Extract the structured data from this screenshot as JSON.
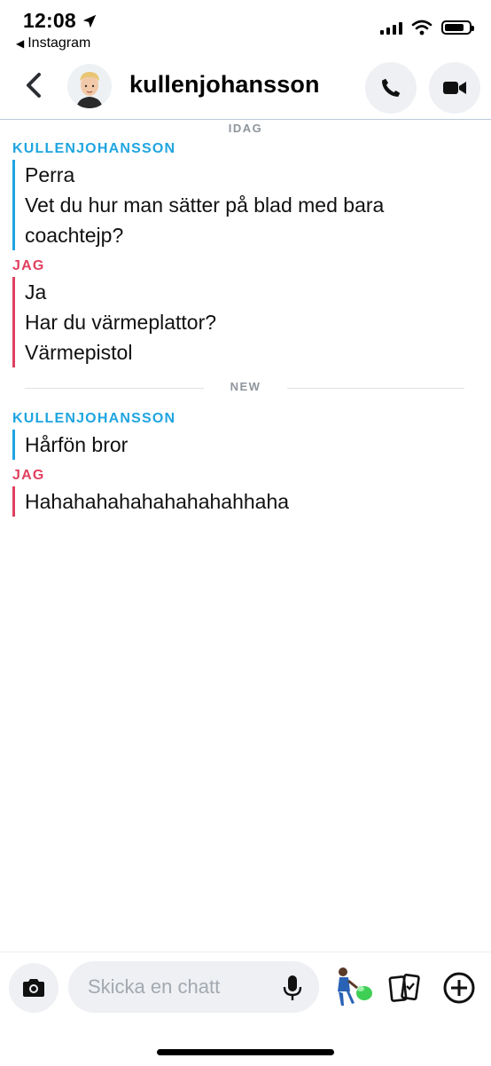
{
  "status_bar": {
    "time": "12:08",
    "back_app": "Instagram",
    "battery_level": 0.8
  },
  "header": {
    "contact_name": "kullenjohansson"
  },
  "chat": {
    "day_label": "IDAG",
    "new_label": "NEW",
    "groups": [
      {
        "sender": "KULLENJOHANSSON",
        "messages": [
          "Perra",
          "Vet du hur man sätter på blad med bara",
          "coachtejp?"
        ]
      },
      {
        "sender": "JAG",
        "messages": [
          "Ja",
          "Har du värmeplattor?",
          "Värmepistol"
        ]
      },
      {
        "sender": "KULLENJOHANSSON",
        "messages": [
          "Hårfön bror"
        ]
      },
      {
        "sender": "JAG",
        "messages": [
          "Hahahahahahahahahahhaha"
        ]
      }
    ]
  },
  "composer": {
    "placeholder": "Skicka en chatt",
    "value": ""
  },
  "colors": {
    "friend": "#1fa5e0",
    "me": "#e0405f",
    "muted": "#8e959c"
  },
  "icons": {
    "location": "location-arrow-icon",
    "back": "chevron-left-icon",
    "call": "phone-icon",
    "video": "video-camera-icon",
    "camera": "camera-icon",
    "mic": "microphone-icon",
    "bitmoji": "bitmoji-icon",
    "cards": "cards-icon",
    "plus": "plus-circle-icon"
  }
}
